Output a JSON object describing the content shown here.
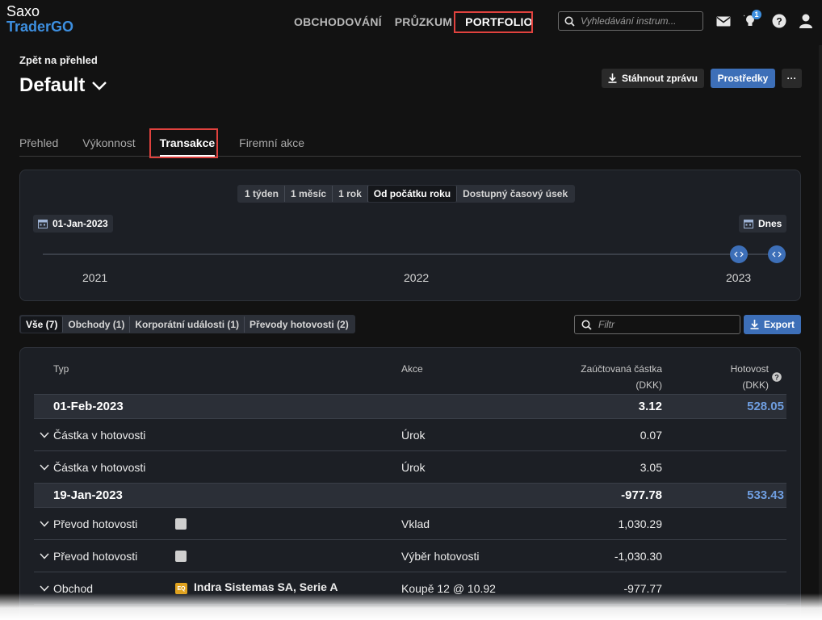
{
  "app": {
    "brand_top": "Saxo",
    "brand_bottom": "TraderGO"
  },
  "nav": {
    "items": [
      {
        "label": "OBCHODOVÁNÍ"
      },
      {
        "label": "PRŮZKUM"
      },
      {
        "label": "PORTFOLIO"
      }
    ],
    "active": "PORTFOLIO"
  },
  "search": {
    "placeholder": "Vyhledávání instrum..."
  },
  "notifications": {
    "count": "1"
  },
  "header": {
    "back_label": "Zpět na přehled",
    "title": "Default",
    "download_label": "Stáhnout zprávu",
    "funds_label": "Prostředky",
    "more_label": "···"
  },
  "tabs": [
    {
      "label": "Přehled"
    },
    {
      "label": "Výkonnost"
    },
    {
      "label": "Transakce"
    },
    {
      "label": "Firemní akce"
    }
  ],
  "active_tab": "Transakce",
  "timeline": {
    "periods": [
      {
        "label": "1 týden"
      },
      {
        "label": "1 měsíc"
      },
      {
        "label": "1 rok"
      },
      {
        "label": "Od počátku roku"
      },
      {
        "label": "Dostupný časový úsek"
      }
    ],
    "active_period": "Od počátku roku",
    "start_date": "01-Jan-2023",
    "end_date": "Dnes",
    "years": [
      {
        "label": "2021"
      },
      {
        "label": "2022"
      },
      {
        "label": "2023"
      }
    ]
  },
  "filters": {
    "items": [
      {
        "label": "Vše (7)"
      },
      {
        "label": "Obchody (1)"
      },
      {
        "label": "Korporátní události (1)"
      },
      {
        "label": "Převody hotovosti (2)"
      }
    ],
    "active": "Vše (7)",
    "filter_placeholder": "Filtr",
    "export_label": "Export"
  },
  "table": {
    "headers": {
      "type": "Typ",
      "action": "Akce",
      "amount_line1": "Zaúčtovaná částka",
      "amount_line2": "(DKK)",
      "cash_line1": "Hotovost",
      "cash_line2": "(DKK)"
    },
    "groups": [
      {
        "date": "01-Feb-2023",
        "total": "3.12",
        "cash": "528.05",
        "rows": [
          {
            "type": "Částka v hotovosti",
            "instrument": "",
            "action": "Úrok",
            "amount": "0.07"
          },
          {
            "type": "Částka v hotovosti",
            "instrument": "",
            "action": "Úrok",
            "amount": "3.05"
          }
        ]
      },
      {
        "date": "19-Jan-2023",
        "total": "-977.78",
        "cash": "533.43",
        "rows": [
          {
            "type": "Převod hotovosti",
            "instrument": "",
            "action": "Vklad",
            "amount": "1,030.29"
          },
          {
            "type": "Převod hotovosti",
            "instrument": "",
            "action": "Výběr hotovosti",
            "amount": "-1,030.30"
          },
          {
            "type": "Obchod",
            "instrument": "Indra Sistemas SA, Serie A",
            "action": "Koupě 12 @ 10.92",
            "amount": "-977.77"
          }
        ]
      }
    ]
  },
  "icons": {
    "eq_badge": "EQ"
  },
  "colors": {
    "accent": "#3d8fe0",
    "button_blue": "#3d6fb8",
    "highlight": "#e0423e",
    "cash_link": "#6f9ee0"
  }
}
